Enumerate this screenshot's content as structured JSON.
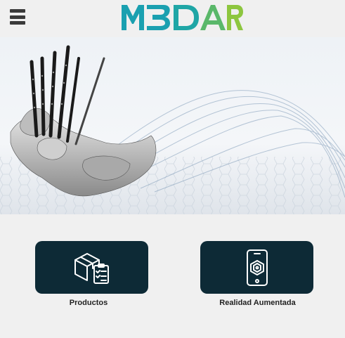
{
  "header": {
    "logo_text": "M3DAR",
    "icons": {
      "menu": "hamburger-menu-icon"
    }
  },
  "colors": {
    "background": "#f0f0f0",
    "logo_teal": "#1aa0b0",
    "logo_green": "#8dc63f",
    "card": "#0d2a36",
    "icon_stroke": "#ffffff"
  },
  "hero": {
    "image": "3D mesh model of foot bones with surgical fixation plates over blue wave background"
  },
  "cards": [
    {
      "label": "Productos",
      "icon": "products-box-checklist-icon"
    },
    {
      "label": "Realidad Aumentada",
      "icon": "ar-smartphone-icon"
    }
  ]
}
